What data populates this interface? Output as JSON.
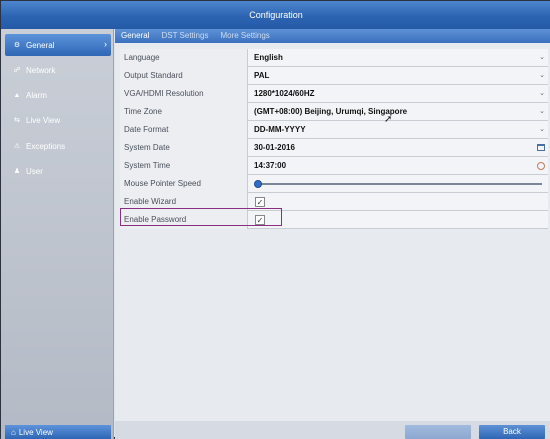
{
  "title": "Configuration",
  "sidebar": {
    "items": [
      {
        "label": "General",
        "icon": "gear-icon"
      },
      {
        "label": "Network",
        "icon": "network-icon"
      },
      {
        "label": "Alarm",
        "icon": "alarm-icon"
      },
      {
        "label": "Live View",
        "icon": "live-view-icon"
      },
      {
        "label": "Exceptions",
        "icon": "warning-icon"
      },
      {
        "label": "User",
        "icon": "user-icon"
      }
    ],
    "bottom_label": "Live View"
  },
  "tabs": [
    "General",
    "DST Settings",
    "More Settings"
  ],
  "settings": [
    {
      "label": "Language",
      "value": "English"
    },
    {
      "label": "Output Standard",
      "value": "PAL"
    },
    {
      "label": "VGA/HDMI Resolution",
      "value": "1280*1024/60HZ"
    },
    {
      "label": "Time Zone",
      "value": "(GMT+08:00) Beijing, Urumqi, Singapore"
    },
    {
      "label": "Date Format",
      "value": "DD-MM-YYYY"
    },
    {
      "label": "System Date",
      "value": "30-01-2016"
    },
    {
      "label": "System Time",
      "value": "14:37:00"
    },
    {
      "label": "Mouse Pointer Speed",
      "value": 0
    },
    {
      "label": "Enable Wizard",
      "value": true
    },
    {
      "label": "Enable Password",
      "value": true
    }
  ],
  "buttons": {
    "back": "Back"
  },
  "colors": {
    "accent": "#2f66b5",
    "highlight_border": "#8a2e82"
  }
}
